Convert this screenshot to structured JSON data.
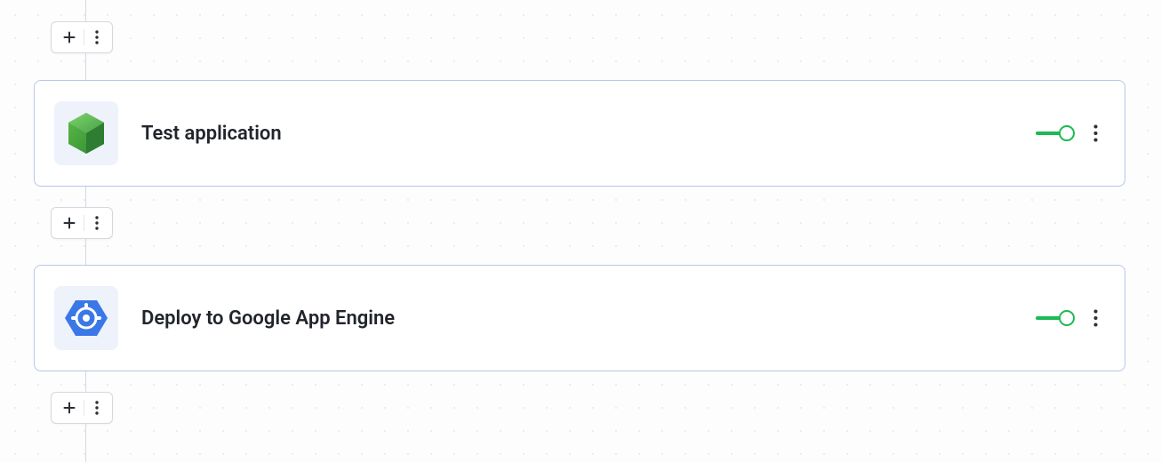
{
  "steps": [
    {
      "label": "Test application",
      "icon": "node",
      "enabled": true
    },
    {
      "label": "Deploy to Google App Engine",
      "icon": "app-engine",
      "enabled": true
    }
  ],
  "colors": {
    "card_border": "#b8c8ea",
    "toggle_on": "#1db954",
    "icon_bg": "#eef2fb"
  }
}
